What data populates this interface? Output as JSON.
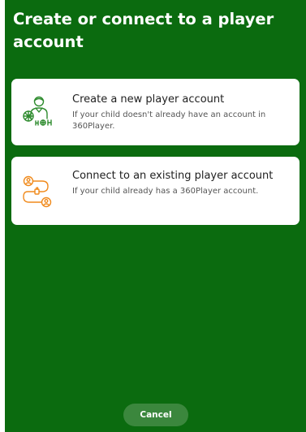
{
  "header": {
    "title": "Create or connect to a player account"
  },
  "options": [
    {
      "title": "Create a new player account",
      "description": "If your child doesn't already have an account in 360Player.",
      "icon": "player-with-ball-icon"
    },
    {
      "title": "Connect to an existing player account",
      "description": "If your child already has a 360Player account.",
      "icon": "link-accounts-icon"
    }
  ],
  "footer": {
    "cancel_label": "Cancel"
  },
  "colors": {
    "background": "#0b6b0f",
    "icon_green": "#2e8b2e",
    "icon_orange": "#f08a1c",
    "cancel_button": "#3b873d"
  }
}
